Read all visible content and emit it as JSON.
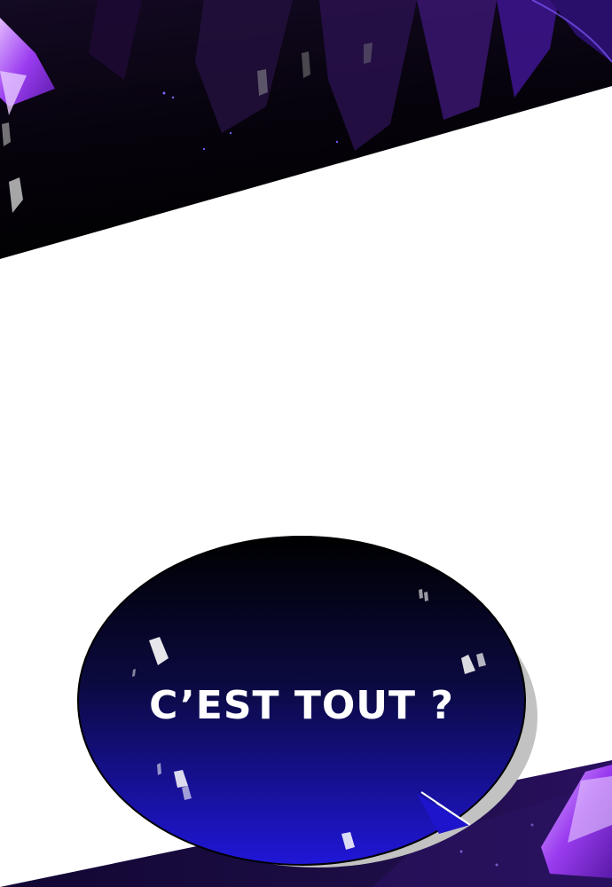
{
  "bubble": {
    "text": "C’EST TOUT ?"
  },
  "colors": {
    "top_panel": "#0b0514",
    "bottom_panel": "#1a0a3a",
    "crystal": "#a347ff",
    "bubble_top": "#000000",
    "bubble_bottom": "#1f14d4",
    "bubble_shadow": "#bfbfbf"
  }
}
